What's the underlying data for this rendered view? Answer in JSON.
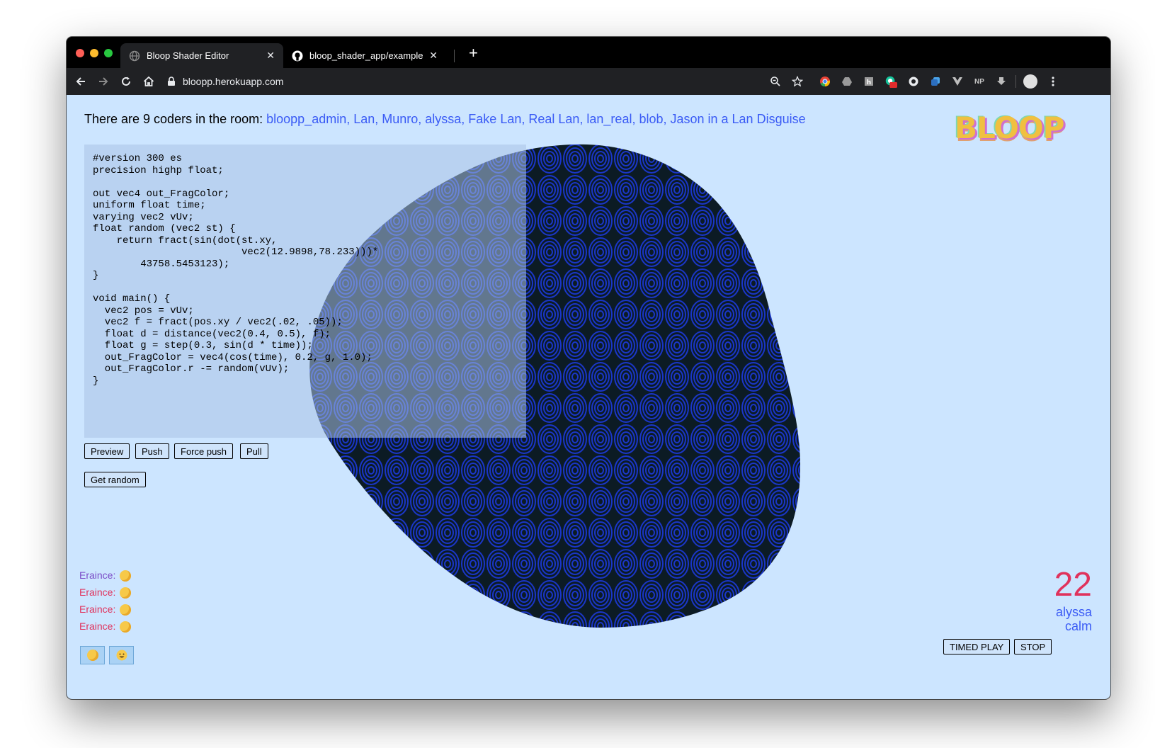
{
  "browser": {
    "tabs": [
      {
        "title": "Bloop Shader Editor",
        "active": true
      },
      {
        "title": "bloop_shader_app/examples.m",
        "active": false
      }
    ],
    "url": "bloopp.herokuapp.com",
    "extensions": [
      "zoom-icon",
      "star-icon",
      "chrome-ext-1",
      "drive-icon",
      "ext-3",
      "grammarly-off",
      "ext-5",
      "ext-6",
      "vue-icon",
      "np-icon",
      "download-ext",
      "profile-avatar",
      "menu-icon"
    ],
    "np_label": "NP",
    "off_badge": "off"
  },
  "room": {
    "prefix": "There are 9 coders in the room: ",
    "names": "bloopp_admin, Lan, Munro, alyssa, Fake Lan, Real Lan, lan_real, blob, Jason in a Lan Disguise"
  },
  "logo": "BLOOP",
  "editor": {
    "code": "#version 300 es\nprecision highp float;\n\nout vec4 out_FragColor;\nuniform float time;\nvarying vec2 vUv;\nfloat random (vec2 st) {\n    return fract(sin(dot(st.xy,\n                         vec2(12.9898,78.233)))*\n        43758.5453123);\n}\n\nvoid main() {\n  vec2 pos = vUv;\n  vec2 f = fract(pos.xy / vec2(.02, .05));\n  float d = distance(vec2(0.4, 0.5), f);\n  float g = step(0.3, sin(d * time));\n  out_FragColor = vec4(cos(time), 0.2, g, 1.0);\n  out_FragColor.r -= random(vUv);\n}"
  },
  "buttons": {
    "preview": "Preview",
    "push": "Push",
    "force_push": "Force push",
    "pull": "Pull",
    "get_random": "Get random",
    "timed_play": "TIMED PLAY",
    "stop": "STOP"
  },
  "chat": [
    {
      "name": "Eraince:",
      "color": "#7a4bc7"
    },
    {
      "name": "Eraince:",
      "color": "#e0325c"
    },
    {
      "name": "Eraince:",
      "color": "#e0325c"
    },
    {
      "name": "Eraince:",
      "color": "#e0325c"
    }
  ],
  "reactions": [
    "clap-emoji",
    "smile-emoji"
  ],
  "status": {
    "score": "22",
    "player": "alyssa",
    "mood": "calm"
  },
  "colors": {
    "page_bg": "#cce5ff",
    "link_blue": "#3a5bf5",
    "accent_red": "#e0325c",
    "shader_blue": "#1a36c8",
    "shader_dark": "#0b1a2a"
  }
}
